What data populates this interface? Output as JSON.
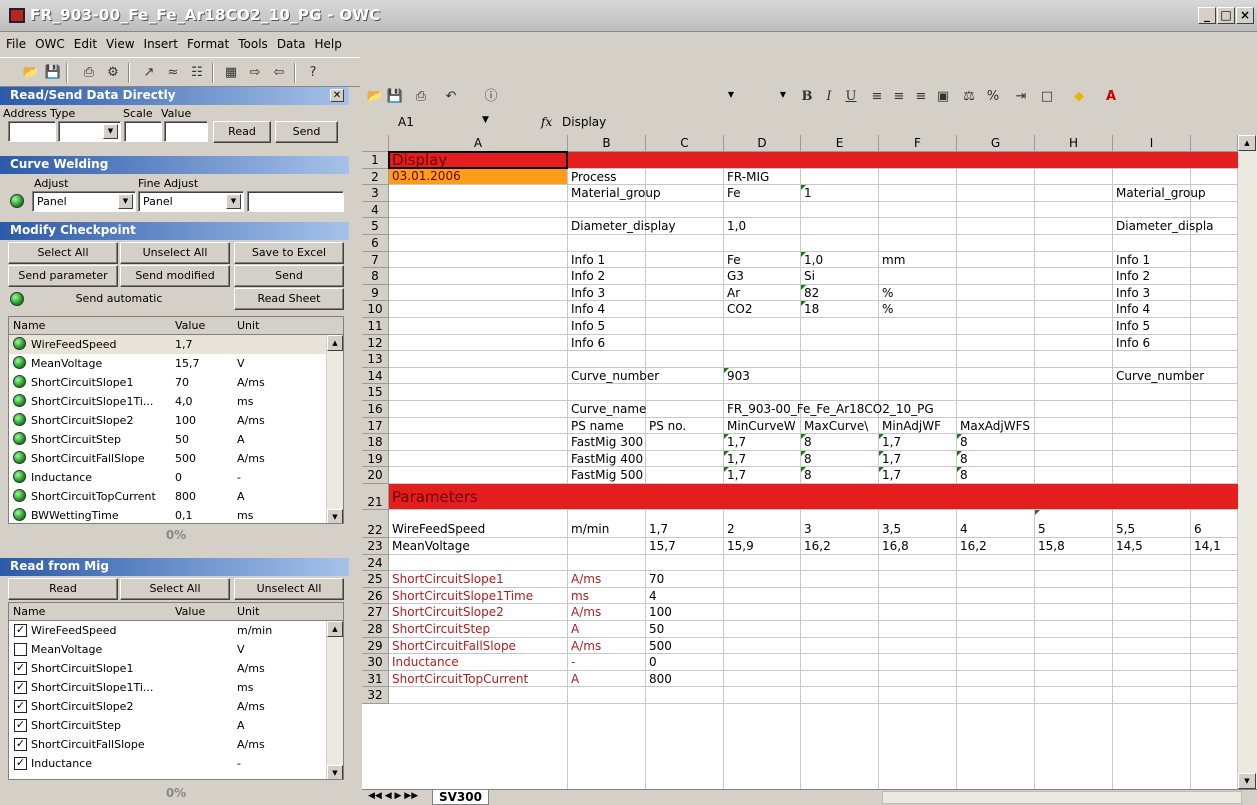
{
  "window": {
    "title": "FR_903-00_Fe_Fe_Ar18CO2_10_PG - OWC",
    "min": "_",
    "max": "□",
    "close": "×"
  },
  "menu": [
    "File",
    "OWC",
    "Edit",
    "View",
    "Insert",
    "Format",
    "Tools",
    "Data",
    "Help"
  ],
  "read_send": {
    "title": "Read/Send Data Directly",
    "address_label": "Address",
    "type_label": "Type",
    "scale_label": "Scale",
    "value_label": "Value",
    "read": "Read",
    "send": "Send"
  },
  "curve_welding": {
    "title": "Curve Welding",
    "adjust_label": "Adjust",
    "fine_label": "Fine Adjust",
    "adjust_value": "Panel",
    "fine_value": "Panel"
  },
  "checkpoint": {
    "title": "Modify Checkpoint",
    "select_all": "Select All",
    "unselect_all": "Unselect All",
    "save_excel": "Save to Excel",
    "send_param": "Send parameter",
    "send_modified": "Send modified",
    "send": "Send",
    "send_auto": "Send automatic",
    "read_sheet": "Read Sheet",
    "col_name": "Name",
    "col_value": "Value",
    "col_unit": "Unit",
    "rows": [
      [
        "WireFeedSpeed",
        "1,7",
        ""
      ],
      [
        "MeanVoltage",
        "15,7",
        "V"
      ],
      [
        "ShortCircuitSlope1",
        "70",
        "A/ms"
      ],
      [
        "ShortCircuitSlope1Ti...",
        "4,0",
        "ms"
      ],
      [
        "ShortCircuitSlope2",
        "100",
        "A/ms"
      ],
      [
        "ShortCircuitStep",
        "50",
        "A"
      ],
      [
        "ShortCircuitFallSlope",
        "500",
        "A/ms"
      ],
      [
        "Inductance",
        "0",
        "-"
      ],
      [
        "ShortCircuitTopCurrent",
        "800",
        "A"
      ],
      [
        "BWWettingTime",
        "0,1",
        "ms"
      ]
    ],
    "progress": "0%"
  },
  "read_mig": {
    "title": "Read from Mig",
    "read": "Read",
    "select_all": "Select All",
    "unselect_all": "Unselect All",
    "col_name": "Name",
    "col_value": "Value",
    "col_unit": "Unit",
    "rows": [
      [
        "WireFeedSpeed",
        "m/min",
        true
      ],
      [
        "MeanVoltage",
        "V",
        false
      ],
      [
        "ShortCircuitSlope1",
        "A/ms",
        true
      ],
      [
        "ShortCircuitSlope1Ti...",
        "ms",
        true
      ],
      [
        "ShortCircuitSlope2",
        "A/ms",
        true
      ],
      [
        "ShortCircuitStep",
        "A",
        true
      ],
      [
        "ShortCircuitFallSlope",
        "A/ms",
        true
      ],
      [
        "Inductance",
        "-",
        true
      ]
    ],
    "progress": "0%"
  },
  "formula": {
    "cell": "A1",
    "fx": "fx",
    "content": "Display"
  },
  "toolbar2": {
    "bold": "B",
    "italic": "I",
    "underline": "U",
    "percent": "%"
  },
  "columns": [
    "A",
    "B",
    "C",
    "D",
    "E",
    "F",
    "G",
    "H",
    "I"
  ],
  "sheet_tab": "SV300",
  "cells": [
    [
      1,
      "A",
      "Display",
      "section"
    ],
    [
      2,
      "A",
      "03.01.2006",
      "date"
    ],
    [
      2,
      "B",
      "Process",
      ""
    ],
    [
      2,
      "D",
      "FR-MIG",
      ""
    ],
    [
      3,
      "B",
      "Material_group",
      ""
    ],
    [
      3,
      "D",
      "Fe",
      ""
    ],
    [
      3,
      "E",
      "1",
      ""
    ],
    [
      3,
      "I",
      "Material_group",
      ""
    ],
    [
      5,
      "B",
      "Diameter_display",
      ""
    ],
    [
      5,
      "D",
      "1,0",
      ""
    ],
    [
      5,
      "I",
      "Diameter_displa",
      ""
    ],
    [
      7,
      "B",
      "Info 1",
      ""
    ],
    [
      7,
      "D",
      "Fe",
      ""
    ],
    [
      7,
      "E",
      "1,0",
      ""
    ],
    [
      7,
      "F",
      "mm",
      ""
    ],
    [
      7,
      "I",
      "Info 1",
      ""
    ],
    [
      8,
      "B",
      "Info 2",
      ""
    ],
    [
      8,
      "D",
      "G3",
      ""
    ],
    [
      8,
      "E",
      "Si",
      ""
    ],
    [
      8,
      "I",
      "Info 2",
      ""
    ],
    [
      9,
      "B",
      "Info 3",
      ""
    ],
    [
      9,
      "D",
      "Ar",
      ""
    ],
    [
      9,
      "E",
      "82",
      ""
    ],
    [
      9,
      "F",
      "%",
      ""
    ],
    [
      9,
      "I",
      "Info 3",
      ""
    ],
    [
      10,
      "B",
      "Info 4",
      ""
    ],
    [
      10,
      "D",
      "CO2",
      ""
    ],
    [
      10,
      "E",
      "18",
      ""
    ],
    [
      10,
      "F",
      "%",
      ""
    ],
    [
      10,
      "I",
      "Info 4",
      ""
    ],
    [
      11,
      "B",
      "Info 5",
      ""
    ],
    [
      11,
      "I",
      "Info 5",
      ""
    ],
    [
      12,
      "B",
      "Info 6",
      ""
    ],
    [
      12,
      "I",
      "Info 6",
      ""
    ],
    [
      14,
      "B",
      "Curve_number",
      ""
    ],
    [
      14,
      "D",
      "903",
      ""
    ],
    [
      14,
      "I",
      "Curve_number",
      ""
    ],
    [
      16,
      "B",
      "Curve_name",
      ""
    ],
    [
      16,
      "D",
      "FR_903-00_Fe_Fe_Ar18CO2_10_PG",
      ""
    ],
    [
      17,
      "B",
      "PS name",
      ""
    ],
    [
      17,
      "C",
      "PS no.",
      ""
    ],
    [
      17,
      "D",
      "MinCurveW",
      ""
    ],
    [
      17,
      "E",
      "MaxCurve\\",
      ""
    ],
    [
      17,
      "F",
      "MinAdjWF",
      ""
    ],
    [
      17,
      "G",
      "MaxAdjWFS",
      ""
    ],
    [
      18,
      "B",
      "FastMig 300",
      ""
    ],
    [
      18,
      "D",
      "1,7",
      ""
    ],
    [
      18,
      "E",
      "8",
      ""
    ],
    [
      18,
      "F",
      "1,7",
      ""
    ],
    [
      18,
      "G",
      "8",
      ""
    ],
    [
      19,
      "B",
      "FastMig 400",
      ""
    ],
    [
      19,
      "D",
      "1,7",
      ""
    ],
    [
      19,
      "E",
      "8",
      ""
    ],
    [
      19,
      "F",
      "1,7",
      ""
    ],
    [
      19,
      "G",
      "8",
      ""
    ],
    [
      20,
      "B",
      "FastMig 500",
      ""
    ],
    [
      20,
      "D",
      "1,7",
      ""
    ],
    [
      20,
      "E",
      "8",
      ""
    ],
    [
      20,
      "F",
      "1,7",
      ""
    ],
    [
      20,
      "G",
      "8",
      ""
    ],
    [
      21,
      "A",
      "Parameters",
      "section"
    ],
    [
      22,
      "A",
      "WireFeedSpeed",
      ""
    ],
    [
      22,
      "B",
      "m/min",
      ""
    ],
    [
      22,
      "C",
      "1,7",
      ""
    ],
    [
      22,
      "D",
      "2",
      ""
    ],
    [
      22,
      "E",
      "3",
      ""
    ],
    [
      22,
      "F",
      "3,5",
      ""
    ],
    [
      22,
      "G",
      "4",
      ""
    ],
    [
      22,
      "H",
      "5",
      ""
    ],
    [
      22,
      "I",
      "5,5",
      ""
    ],
    [
      22,
      "J",
      "6",
      ""
    ],
    [
      23,
      "A",
      "MeanVoltage",
      ""
    ],
    [
      23,
      "C",
      "15,7",
      ""
    ],
    [
      23,
      "D",
      "15,9",
      ""
    ],
    [
      23,
      "E",
      "16,2",
      ""
    ],
    [
      23,
      "F",
      "16,8",
      ""
    ],
    [
      23,
      "G",
      "16,2",
      ""
    ],
    [
      23,
      "H",
      "15,8",
      ""
    ],
    [
      23,
      "I",
      "14,5",
      ""
    ],
    [
      23,
      "J",
      "14,1",
      ""
    ],
    [
      25,
      "A",
      "ShortCircuitSlope1",
      "red"
    ],
    [
      25,
      "B",
      "A/ms",
      "red"
    ],
    [
      25,
      "C",
      "70",
      ""
    ],
    [
      26,
      "A",
      "ShortCircuitSlope1Time",
      "red"
    ],
    [
      26,
      "B",
      "ms",
      "red"
    ],
    [
      26,
      "C",
      "4",
      ""
    ],
    [
      27,
      "A",
      "ShortCircuitSlope2",
      "red"
    ],
    [
      27,
      "B",
      "A/ms",
      "red"
    ],
    [
      27,
      "C",
      "100",
      ""
    ],
    [
      28,
      "A",
      "ShortCircuitStep",
      "red"
    ],
    [
      28,
      "B",
      "A",
      "red"
    ],
    [
      28,
      "C",
      "50",
      ""
    ],
    [
      29,
      "A",
      "ShortCircuitFallSlope",
      "red"
    ],
    [
      29,
      "B",
      "A/ms",
      "red"
    ],
    [
      29,
      "C",
      "500",
      ""
    ],
    [
      30,
      "A",
      "Inductance",
      "red"
    ],
    [
      30,
      "B",
      "-",
      "red"
    ],
    [
      30,
      "C",
      "0",
      ""
    ],
    [
      31,
      "A",
      "ShortCircuitTopCurrent",
      "red"
    ],
    [
      31,
      "B",
      "A",
      "red"
    ],
    [
      31,
      "C",
      "800",
      ""
    ]
  ],
  "green_marks": [
    "3E",
    "7E",
    "9E",
    "10E",
    "14D",
    "18D",
    "18E",
    "18F",
    "18G",
    "19D",
    "19E",
    "19F",
    "19G",
    "20D",
    "20E",
    "20F",
    "20G",
    "22H"
  ],
  "colors": {
    "section": "#e41e1e",
    "date": "#ff9c1a",
    "accent": "#2c5aa8"
  }
}
